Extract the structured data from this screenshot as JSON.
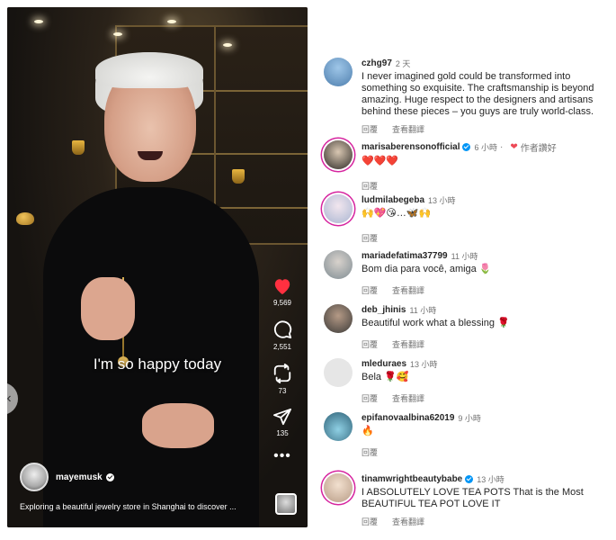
{
  "reel": {
    "caption": "I'm so happy today",
    "owner": "mayemusk",
    "description": "Exploring a beautiful jewelry store in Shanghai to discover ...",
    "likes": "9,569",
    "comments": "2,551",
    "reposts": "73",
    "shares": "135",
    "more": "•••"
  },
  "ui": {
    "reply": "回覆",
    "see_translation": "查看翻譯",
    "author_liked": "作者讚好",
    "prev": "‹"
  },
  "comments": [
    {
      "user": "czhg97",
      "time": "2 天",
      "verified": false,
      "text": "I never imagined gold could be transformed into something so exquisite. The craftsmanship is beyond amazing. Huge respect to the designers and artisans behind these pieces – you guys are truly world-class.",
      "show_translation": true,
      "avatar_color": "#4f7fae"
    },
    {
      "user": "marisaberensonofficial",
      "time": "6 小時",
      "verified": true,
      "author_liked": true,
      "text": "❤️❤️❤️",
      "show_translation": false,
      "avatar_color": "#2d2a26"
    },
    {
      "user": "ludmilabegeba",
      "time": "13 小時",
      "verified": false,
      "text": "🙌💖😘…🦋🙌",
      "show_translation": false,
      "avatar_color": "#d7c6d1"
    },
    {
      "user": "mariadefatima37799",
      "time": "11 小時",
      "verified": false,
      "text": "Bom dia para você, amiga 🌷",
      "show_translation": true,
      "avatar_color": "#7f8c93"
    },
    {
      "user": "deb_jhinis",
      "time": "11 小時",
      "verified": false,
      "text": "Beautiful work what a blessing 🌹",
      "show_translation": true,
      "avatar_color": "#3b3a38"
    },
    {
      "user": "mleduraes",
      "time": "13 小時",
      "verified": false,
      "text": "Bela 🌹🥰",
      "show_translation": true,
      "avatar_color": "#e6e6e6"
    },
    {
      "user": "epifanovaalbina62019",
      "time": "9 小時",
      "verified": false,
      "text": "🔥",
      "show_translation": false,
      "avatar_color": "#5c8fa6"
    },
    {
      "user": "tinamwrightbeautybabe",
      "time": "13 小時",
      "verified": true,
      "text": "I ABSOLUTELY LOVE TEA POTS That is the Most BEAUTIFUL TEA POT LOVE IT",
      "show_translation": true,
      "avatar_color": "#c9b39e"
    }
  ]
}
